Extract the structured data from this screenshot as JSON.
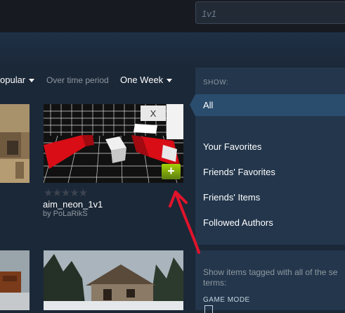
{
  "search": {
    "value": "1v1"
  },
  "filter_bar": {
    "sort_value": "opular",
    "period_label": "Over time period",
    "period_value": "One Week"
  },
  "featured_item": {
    "title": "aim_neon_1v1",
    "author": "by PoLaRikS",
    "rating_stars": 0,
    "rating_max": 5,
    "stars_text": "★★★★★",
    "add_label": "+"
  },
  "sidebar": {
    "show_label": "SHOW:",
    "items": [
      {
        "label": "All",
        "active": true
      },
      {
        "label": "Your Favorites"
      },
      {
        "label": "Friends' Favorites"
      },
      {
        "label": "Friends' Items"
      },
      {
        "label": "Followed Authors"
      }
    ],
    "tag_text": "Show items tagged with all of the se terms:",
    "game_mode_label": "GAME MODE"
  },
  "colors": {
    "background": "#1b2838",
    "sidebar": "#23364c",
    "active_item": "#2a4d6e",
    "add_button": "#a4d007",
    "annotation_arrow": "#e0142b"
  },
  "icons": {
    "sort_caret": "chevron-down-icon",
    "period_caret": "chevron-down-icon",
    "add": "plus-icon",
    "annotation": "red-arrow-annotation"
  }
}
